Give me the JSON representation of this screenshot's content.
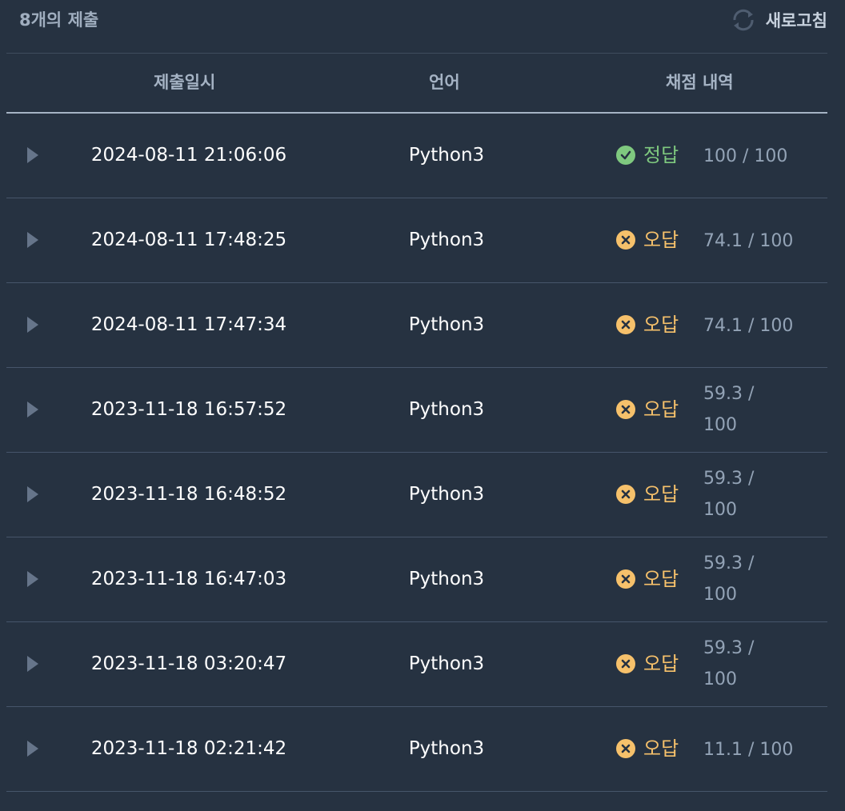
{
  "header": {
    "count_label": "8개의 제출",
    "refresh_label": "새로고침",
    "refresh_icon": "refresh-icon"
  },
  "table": {
    "columns": [
      "제출일시",
      "언어",
      "채점 내역"
    ],
    "rows": [
      {
        "date": "2024-08-11 21:06:06",
        "language": "Python3",
        "status": "정답",
        "status_type": "correct",
        "score_line1": "100 / 100",
        "score_line2": ""
      },
      {
        "date": "2024-08-11 17:48:25",
        "language": "Python3",
        "status": "오답",
        "status_type": "wrong",
        "score_line1": "74.1 / 100",
        "score_line2": ""
      },
      {
        "date": "2024-08-11 17:47:34",
        "language": "Python3",
        "status": "오답",
        "status_type": "wrong",
        "score_line1": "74.1 / 100",
        "score_line2": ""
      },
      {
        "date": "2023-11-18 16:57:52",
        "language": "Python3",
        "status": "오답",
        "status_type": "wrong",
        "score_line1": "59.3 /",
        "score_line2": "100"
      },
      {
        "date": "2023-11-18 16:48:52",
        "language": "Python3",
        "status": "오답",
        "status_type": "wrong",
        "score_line1": "59.3 /",
        "score_line2": "100"
      },
      {
        "date": "2023-11-18 16:47:03",
        "language": "Python3",
        "status": "오답",
        "status_type": "wrong",
        "score_line1": "59.3 /",
        "score_line2": "100"
      },
      {
        "date": "2023-11-18 03:20:47",
        "language": "Python3",
        "status": "오답",
        "status_type": "wrong",
        "score_line1": "59.3 /",
        "score_line2": "100"
      },
      {
        "date": "2023-11-18 02:21:42",
        "language": "Python3",
        "status": "오답",
        "status_type": "wrong",
        "score_line1": "11.1 / 100",
        "score_line2": ""
      }
    ]
  },
  "colors": {
    "background": "#263241",
    "correct": "#7fc97f",
    "wrong": "#f6c16b",
    "muted": "#93a3b6"
  }
}
